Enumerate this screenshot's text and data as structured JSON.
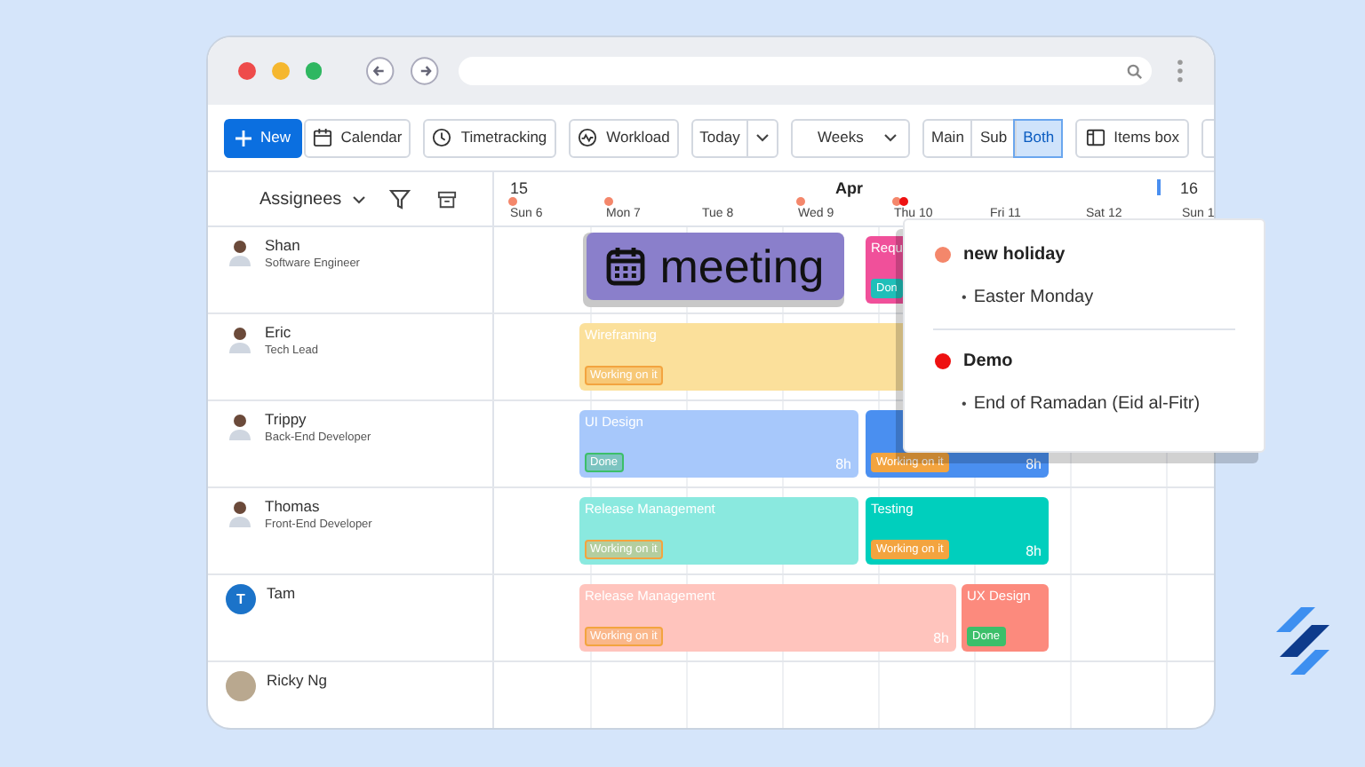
{
  "toolbar": {
    "items": [
      {
        "kind": "primary",
        "label": "New"
      },
      {
        "kind": "button",
        "label": "Calendar"
      },
      {
        "kind": "button",
        "label": "Timetracking"
      },
      {
        "kind": "button",
        "label": "Workload"
      },
      {
        "kind": "split",
        "label": "Today"
      },
      {
        "kind": "dropdown",
        "label": "Weeks"
      },
      {
        "kind": "segmented"
      },
      {
        "kind": "button",
        "label": "Items box"
      },
      {
        "kind": "refresh"
      }
    ],
    "view_modes": [
      {
        "label": "Main",
        "selected": false
      },
      {
        "label": "Sub",
        "selected": false
      },
      {
        "label": "Both",
        "selected": true
      }
    ]
  },
  "sidebar_header": {
    "label": "Assignees"
  },
  "timeline_header": {
    "week": "15",
    "month": "Apr",
    "next_week": "16",
    "days": [
      {
        "label": "Sun 6",
        "dots": [
          {
            "color": "#f4876b"
          }
        ]
      },
      {
        "label": "Mon 7",
        "dots": [
          {
            "color": "#f4876b"
          }
        ]
      },
      {
        "label": "Tue 8"
      },
      {
        "label": "Wed 9",
        "dots": [
          {
            "color": "#f4876b"
          }
        ]
      },
      {
        "label": "Thu 10",
        "dots": [
          {
            "color": "#f4876b"
          },
          {
            "color": "#ee1111"
          }
        ]
      },
      {
        "label": "Fri 11"
      },
      {
        "label": "Sat 12"
      },
      {
        "label": "Sun 1"
      }
    ]
  },
  "assignees": [
    {
      "kind": "person",
      "name": "Shan",
      "role": "Software Engineer",
      "tasks": [
        {
          "kind": "meeting",
          "title": "meeting"
        },
        {
          "kind": "task",
          "title": "Requ",
          "color": "#f0509a",
          "status": {
            "label": "Don",
            "color": "#1fbfb9",
            "faded": false
          }
        }
      ]
    },
    {
      "kind": "person",
      "name": "Eric",
      "role": "Tech Lead",
      "tasks": [
        {
          "kind": "task",
          "title": "Wireframing",
          "color": "#fbe09b",
          "status": {
            "label": "Working on it",
            "color": "#f3a43f",
            "faded": true
          }
        }
      ]
    },
    {
      "kind": "person",
      "name": "Trippy",
      "role": "Back-End Developer",
      "tasks": [
        {
          "kind": "task",
          "title": "UI Design",
          "hours": "8h",
          "color": "#a7c8fb",
          "status": {
            "label": "Done",
            "color": "#3cbf6a",
            "faded": true
          }
        },
        {
          "kind": "task",
          "hours": "8h",
          "color": "#4a8ff0",
          "status": {
            "label": "Working on it",
            "color": "#f3a43f",
            "faded": false
          }
        }
      ]
    },
    {
      "kind": "person",
      "name": "Thomas",
      "role": "Front-End Developer",
      "tasks": [
        {
          "kind": "task",
          "title": "Release Management",
          "color": "#8ae9df",
          "status": {
            "label": "Working on it",
            "color": "#f3a43f",
            "faded": true
          }
        },
        {
          "kind": "task",
          "title": "Testing",
          "hours": "8h",
          "color": "#00cfbd",
          "status": {
            "label": "Working on it",
            "color": "#f3a43f",
            "faded": false
          }
        }
      ]
    },
    {
      "kind": "initial",
      "name": "Tam",
      "initial": "T",
      "tasks": [
        {
          "kind": "task",
          "title": "Release Management",
          "hours": "8h",
          "color": "#ffc4bd",
          "status": {
            "label": "Working on it",
            "color": "#f3a43f",
            "faded": true
          }
        },
        {
          "kind": "task",
          "title": "UX Design",
          "color": "#fc8a7d",
          "status": {
            "label": "Done",
            "color": "#3cbf6a",
            "faded": false
          }
        }
      ]
    },
    {
      "kind": "photo",
      "name": "Ricky Ng"
    }
  ],
  "popup": {
    "groups": [
      {
        "name": "new holiday",
        "color": "#f4876b",
        "items": [
          {
            "marker": "•",
            "text": "Easter Monday"
          }
        ]
      },
      {
        "name": "Demo",
        "color": "#ee1111",
        "items": [
          {
            "marker": "•",
            "text": "End of Ramadan (Eid al-Fitr)"
          }
        ]
      }
    ]
  }
}
